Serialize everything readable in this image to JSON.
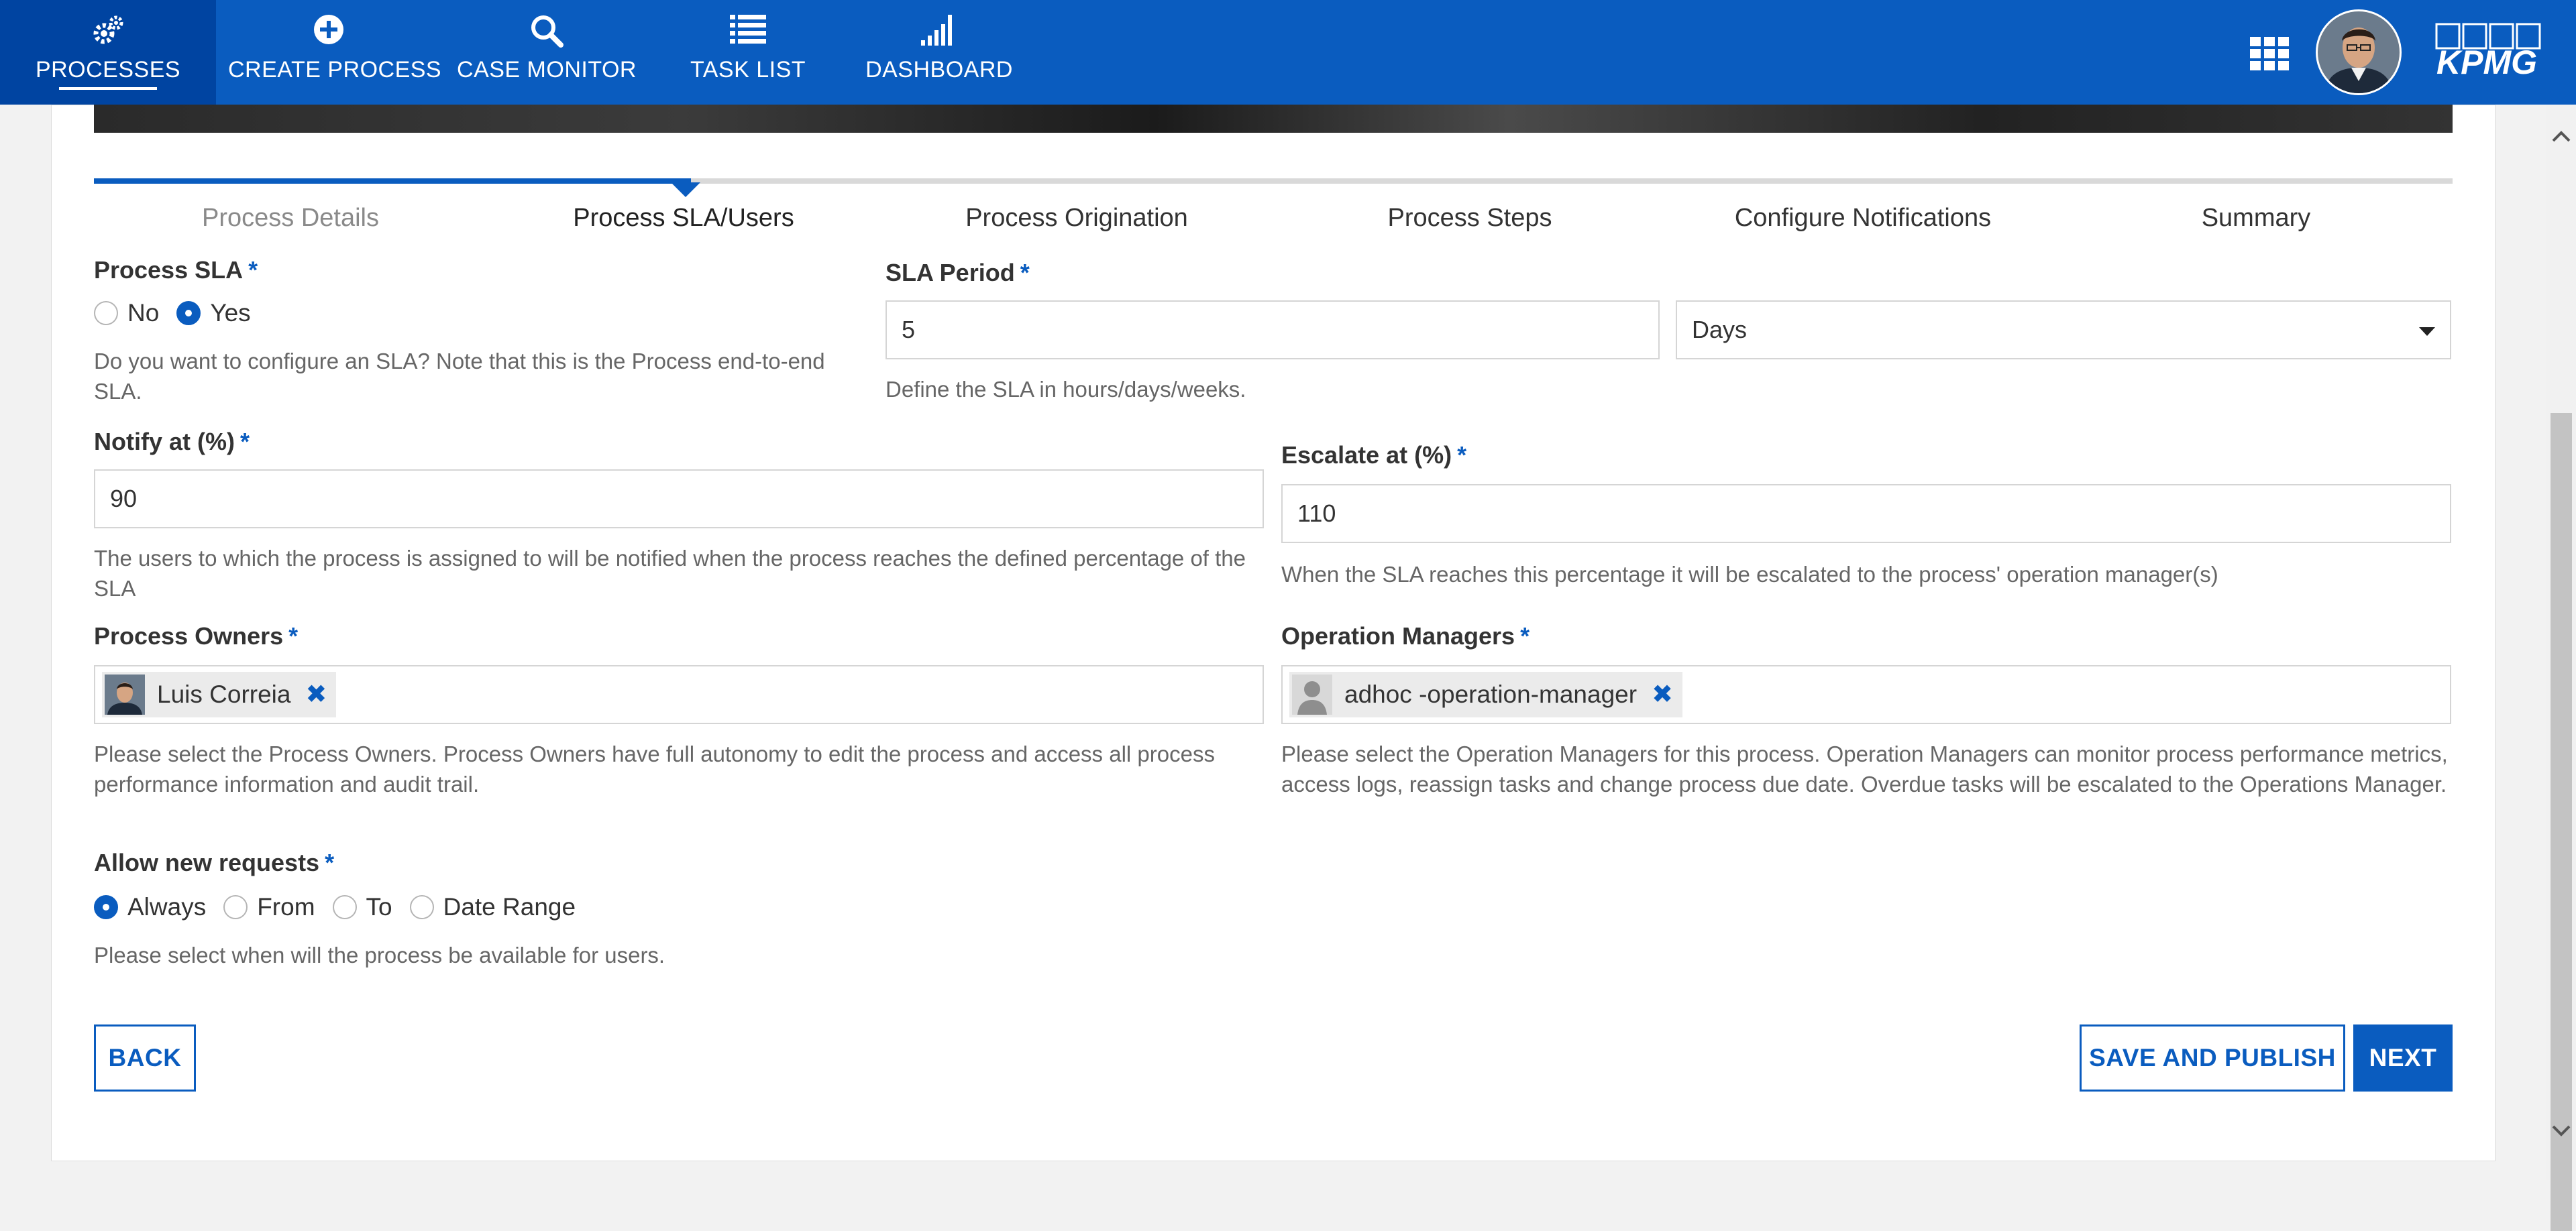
{
  "nav": {
    "items": [
      {
        "label": "PROCESSES",
        "icon": "gears-icon",
        "active": true
      },
      {
        "label": "CREATE PROCESS",
        "icon": "plus-circle-icon"
      },
      {
        "label": "CASE MONITOR",
        "icon": "search-icon"
      },
      {
        "label": "TASK LIST",
        "icon": "list-icon"
      },
      {
        "label": "DASHBOARD",
        "icon": "signal-bars-icon"
      }
    ],
    "brand": "KPMG"
  },
  "stepper": {
    "steps": [
      "Process Details",
      "Process SLA/Users",
      "Process Origination",
      "Process Steps",
      "Configure Notifications",
      "Summary"
    ],
    "current_index": 1
  },
  "form": {
    "process_sla": {
      "label": "Process SLA",
      "options": [
        "No",
        "Yes"
      ],
      "selected": "Yes",
      "help": "Do you want to configure an SLA? Note that this is the Process end-to-end SLA."
    },
    "sla_period": {
      "label": "SLA Period",
      "value": "5",
      "unit": "Days",
      "help": "Define the SLA in hours/days/weeks."
    },
    "notify_at": {
      "label": "Notify at (%)",
      "value": "90",
      "help": "The users to which the process is assigned to will be notified when the process reaches the defined percentage of the SLA"
    },
    "escalate_at": {
      "label": "Escalate at (%)",
      "value": "110",
      "help": "When the SLA reaches this percentage it will be escalated to the process' operation manager(s)"
    },
    "process_owners": {
      "label": "Process Owners",
      "chips": [
        "Luis Correia"
      ],
      "help": "Please select the Process Owners. Process Owners have full autonomy to edit the process and access all process performance information and audit trail."
    },
    "operation_managers": {
      "label": "Operation Managers",
      "chips": [
        "adhoc -operation-manager"
      ],
      "help": "Please select the Operation Managers for this process. Operation Managers can monitor process performance metrics, access logs, reassign tasks and change process due date. Overdue tasks will be escalated to the Operations Manager."
    },
    "allow_new_requests": {
      "label": "Allow new requests",
      "options": [
        "Always",
        "From",
        "To",
        "Date Range"
      ],
      "selected": "Always",
      "help": "Please select when will the process be available for users."
    },
    "required_mark": "*"
  },
  "buttons": {
    "back": "BACK",
    "save_publish": "SAVE AND PUBLISH",
    "next": "NEXT"
  },
  "colors": {
    "primary": "#0a5cbf",
    "nav_active": "#0044a1"
  }
}
